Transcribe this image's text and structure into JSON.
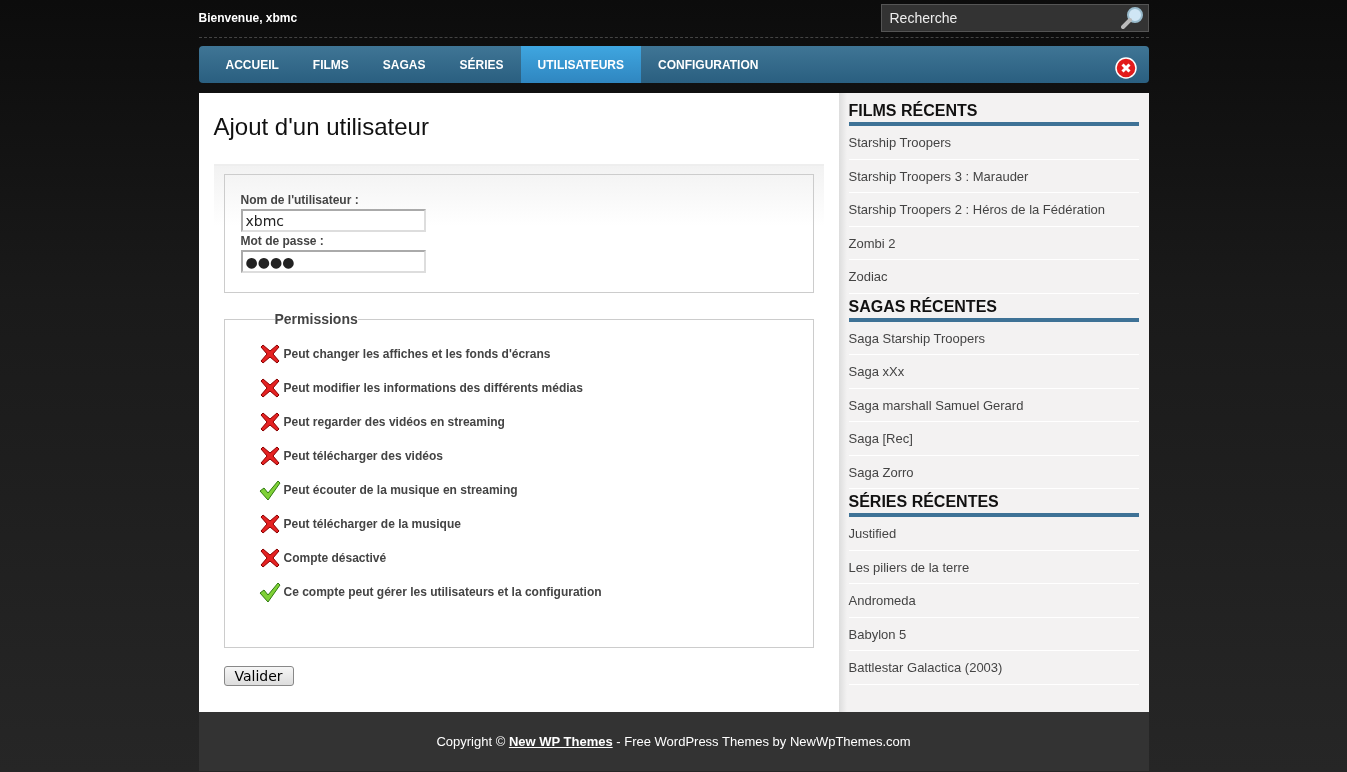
{
  "header": {
    "welcome": "Bienvenue, xbmc",
    "search": {
      "placeholder": "Recherche"
    }
  },
  "nav": {
    "items": [
      {
        "label": "ACCUEIL",
        "selected": false
      },
      {
        "label": "FILMS",
        "selected": false
      },
      {
        "label": "SAGAS",
        "selected": false
      },
      {
        "label": "SÉRIES",
        "selected": false
      },
      {
        "label": "UTILISATEURS",
        "selected": true
      },
      {
        "label": "CONFIGURATION",
        "selected": false
      }
    ]
  },
  "main": {
    "title": "Ajout d'un utilisateur",
    "fields": [
      {
        "label": "Nom de l'utilisateur :",
        "value": "xbmc"
      },
      {
        "label": "Mot de passe :",
        "value": "●●●●"
      }
    ],
    "permissions": {
      "legend": "Permissions",
      "items": [
        {
          "label": "Peut changer les affiches et les fonds d'écrans",
          "checked": false
        },
        {
          "label": "Peut modifier les informations des différents médias",
          "checked": false
        },
        {
          "label": "Peut regarder des vidéos en streaming",
          "checked": false
        },
        {
          "label": "Peut télécharger des vidéos",
          "checked": false
        },
        {
          "label": "Peut écouter de la musique en streaming",
          "checked": true
        },
        {
          "label": "Peut télécharger de la musique",
          "checked": false
        },
        {
          "label": "Compte désactivé",
          "checked": false
        },
        {
          "label": "Ce compte peut gérer les utilisateurs et la configuration",
          "checked": true
        }
      ]
    },
    "submit": "Valider"
  },
  "sidebar": {
    "sections": [
      {
        "title": "FILMS RÉCENTS",
        "items": [
          "Starship Troopers",
          "Starship Troopers 3 : Marauder",
          "Starship Troopers 2 : Héros de la Fédération",
          "Zombi 2",
          "Zodiac"
        ]
      },
      {
        "title": "SAGAS RÉCENTES",
        "items": [
          "Saga Starship Troopers",
          "Saga xXx",
          "Saga marshall Samuel Gerard",
          "Saga [Rec]",
          "Saga Zorro"
        ]
      },
      {
        "title": "SÉRIES RÉCENTES",
        "items": [
          "Justified",
          "Les piliers de la terre",
          "Andromeda",
          "Babylon 5",
          "Battlestar Galactica (2003)"
        ]
      }
    ]
  },
  "footer": {
    "prefix": "Copyright © ",
    "link": "New WP Themes",
    "suffix": " - Free WordPress Themes by NewWpThemes.com"
  }
}
